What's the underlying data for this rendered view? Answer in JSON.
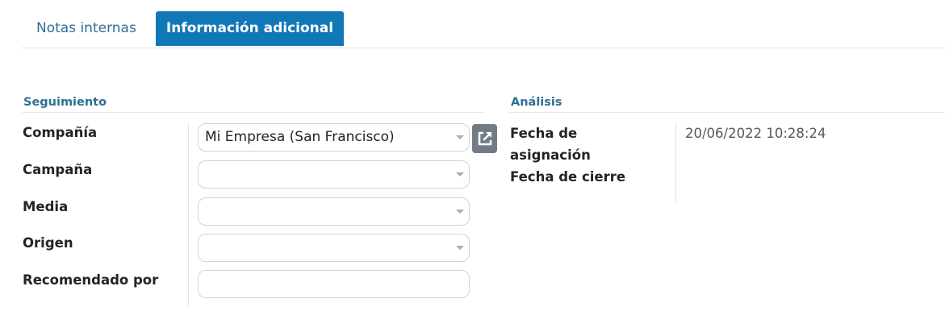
{
  "tabs": [
    {
      "label": "Notas internas",
      "active": false
    },
    {
      "label": "Información adicional",
      "active": true
    }
  ],
  "seguimiento": {
    "title": "Seguimiento",
    "fields": [
      {
        "label": "Compañía",
        "value": "Mi Empresa (San Francisco)",
        "type": "select"
      },
      {
        "label": "Campaña",
        "value": "",
        "type": "select"
      },
      {
        "label": "Media",
        "value": "",
        "type": "select"
      },
      {
        "label": "Origen",
        "value": "",
        "type": "select"
      },
      {
        "label": "Recomendado por",
        "value": "",
        "type": "text"
      }
    ],
    "external_link_icon": "external-link-icon"
  },
  "analisis": {
    "title": "Análisis",
    "fields": [
      {
        "label_line1": "Fecha de",
        "label_line2": "asignación",
        "value": "20/06/2022 10:28:24"
      },
      {
        "label": "Fecha de cierre",
        "value": ""
      }
    ]
  },
  "colors": {
    "accent": "#1178b8",
    "section_title": "#2f6f93",
    "icon_button": "#737b86"
  }
}
